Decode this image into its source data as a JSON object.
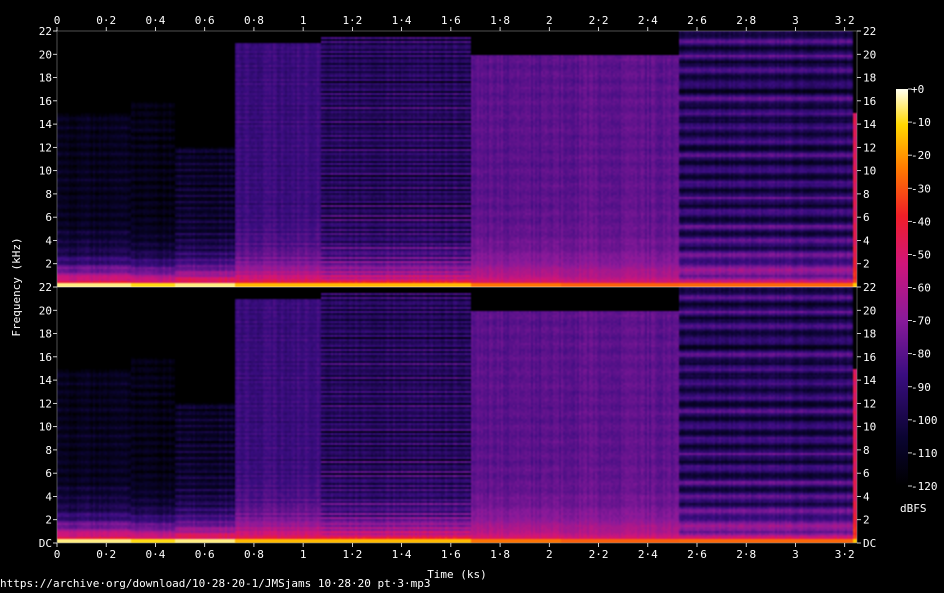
{
  "chart_data": {
    "type": "heatmap",
    "title": "",
    "xlabel": "Time (ks)",
    "ylabel": "Frequency (kHz)",
    "colorbar_label": "dBFS",
    "x_ticks": [
      "0",
      "0·2",
      "0·4",
      "0·6",
      "0·8",
      "1",
      "1·2",
      "1·4",
      "1·6",
      "1·8",
      "2",
      "2·2",
      "2·4",
      "2·6",
      "2·8",
      "3",
      "3·2"
    ],
    "x_tick_values": [
      0,
      0.2,
      0.4,
      0.6,
      0.8,
      1.0,
      1.2,
      1.4,
      1.6,
      1.8,
      2.0,
      2.2,
      2.4,
      2.6,
      2.8,
      3.0,
      3.2
    ],
    "xlim": [
      0,
      3.25
    ],
    "y_ticks": [
      "2",
      "4",
      "6",
      "8",
      "10",
      "12",
      "14",
      "16",
      "18",
      "20",
      "22"
    ],
    "y_tick_values": [
      2,
      4,
      6,
      8,
      10,
      12,
      14,
      16,
      18,
      20,
      22
    ],
    "y_zero_label": "DC",
    "ylim": [
      0,
      22
    ],
    "colorbar_ticks": [
      "+0",
      "-10",
      "-20",
      "-30",
      "-40",
      "-50",
      "-60",
      "-70",
      "-80",
      "-90",
      "-100",
      "-110",
      "-120"
    ],
    "colorbar_values": [
      0,
      -10,
      -20,
      -30,
      -40,
      -50,
      -60,
      -70,
      -80,
      -90,
      -100,
      -110,
      -120
    ],
    "colorbar_range": [
      -120,
      0
    ],
    "channels": 2,
    "segments": [
      {
        "start": 0.0,
        "end": 0.3,
        "cutoff_khz": 15,
        "floor_db": -112,
        "low_db": -20,
        "band_rate": 0.75,
        "band_amp": 10
      },
      {
        "start": 0.3,
        "end": 0.48,
        "cutoff_khz": 16,
        "floor_db": -114,
        "low_db": -25,
        "band_rate": 0.7,
        "band_amp": 10
      },
      {
        "start": 0.48,
        "end": 0.72,
        "cutoff_khz": 12,
        "floor_db": -108,
        "low_db": -20,
        "band_rate": 0.55,
        "band_amp": 14
      },
      {
        "start": 0.72,
        "end": 1.07,
        "cutoff_khz": 21,
        "floor_db": -87,
        "low_db": -30,
        "band_rate": 0.3,
        "band_amp": 6
      },
      {
        "start": 1.07,
        "end": 1.68,
        "cutoff_khz": 21.5,
        "floor_db": -95,
        "low_db": -30,
        "band_rate": 0.3,
        "band_amp": 26
      },
      {
        "start": 1.68,
        "end": 2.05,
        "cutoff_khz": 20,
        "floor_db": -80,
        "low_db": -40,
        "band_rate": 1.2,
        "band_amp": 3
      },
      {
        "start": 2.05,
        "end": 2.53,
        "cutoff_khz": 20,
        "floor_db": -79,
        "low_db": -43,
        "band_rate": 1.2,
        "band_amp": 3
      },
      {
        "start": 2.53,
        "end": 3.23,
        "cutoff_khz": 22,
        "floor_db": -95,
        "low_db": -42,
        "band_rate": 0.2,
        "band_amp": 26
      },
      {
        "start": 3.23,
        "end": 3.25,
        "cutoff_khz": 15,
        "floor_db": -48,
        "low_db": -28,
        "band_rate": 1.0,
        "band_amp": 4
      }
    ]
  },
  "footer": {
    "source_url": "https://archive·org/download/10·28·20-1/JMSjams 10·28·20 pt·3·mp3"
  }
}
